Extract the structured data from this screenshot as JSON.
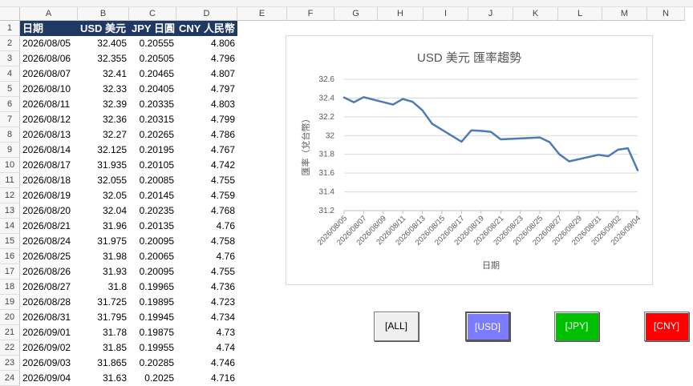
{
  "columns": [
    "A",
    "B",
    "C",
    "D",
    "E",
    "F",
    "G",
    "H",
    "I",
    "J",
    "K",
    "L",
    "M",
    "N"
  ],
  "headers": {
    "date": "日期",
    "usd": "USD 美元",
    "jpy": "JPY 日圓",
    "cny": "CNY 人民幣"
  },
  "rows": [
    [
      "2026/08/05",
      "32.405",
      "0.20555",
      "4.806"
    ],
    [
      "2026/08/06",
      "32.355",
      "0.20505",
      "4.796"
    ],
    [
      "2026/08/07",
      "32.41",
      "0.20465",
      "4.807"
    ],
    [
      "2026/08/10",
      "32.33",
      "0.20405",
      "4.797"
    ],
    [
      "2026/08/11",
      "32.39",
      "0.20335",
      "4.803"
    ],
    [
      "2026/08/12",
      "32.36",
      "0.20315",
      "4.799"
    ],
    [
      "2026/08/13",
      "32.27",
      "0.20265",
      "4.786"
    ],
    [
      "2026/08/14",
      "32.125",
      "0.20195",
      "4.767"
    ],
    [
      "2026/08/17",
      "31.935",
      "0.20105",
      "4.742"
    ],
    [
      "2026/08/18",
      "32.055",
      "0.20085",
      "4.755"
    ],
    [
      "2026/08/19",
      "32.05",
      "0.20145",
      "4.759"
    ],
    [
      "2026/08/20",
      "32.04",
      "0.20235",
      "4.768"
    ],
    [
      "2026/08/21",
      "31.96",
      "0.20135",
      "4.76"
    ],
    [
      "2026/08/24",
      "31.975",
      "0.20095",
      "4.758"
    ],
    [
      "2026/08/25",
      "31.98",
      "0.20065",
      "4.76"
    ],
    [
      "2026/08/26",
      "31.93",
      "0.20095",
      "4.755"
    ],
    [
      "2026/08/27",
      "31.8",
      "0.19965",
      "4.736"
    ],
    [
      "2026/08/28",
      "31.725",
      "0.19895",
      "4.723"
    ],
    [
      "2026/08/31",
      "31.795",
      "0.19945",
      "4.734"
    ],
    [
      "2026/09/01",
      "31.78",
      "0.19875",
      "4.73"
    ],
    [
      "2026/09/02",
      "31.85",
      "0.19955",
      "4.74"
    ],
    [
      "2026/09/03",
      "31.865",
      "0.20285",
      "4.746"
    ],
    [
      "2026/09/04",
      "31.63",
      "0.2025",
      "4.716"
    ]
  ],
  "buttons": {
    "all": "[ALL]",
    "usd": "[USD]",
    "jpy": "[JPY]",
    "cny": "[CNY]"
  },
  "chart_data": {
    "type": "line",
    "title": "USD 美元 匯率趨勢",
    "xlabel": "日期",
    "ylabel": "匯率（兌台幣）",
    "ylim": [
      31.2,
      32.6
    ],
    "yticks": [
      "31.2",
      "31.4",
      "31.6",
      "31.8",
      "32",
      "32.2",
      "32.4",
      "32.6"
    ],
    "grid": true,
    "x_axis_type": "date",
    "xticks": [
      "2026/08/05",
      "2026/08/07",
      "2026/08/09",
      "2026/08/11",
      "2026/08/13",
      "2026/08/15",
      "2026/08/17",
      "2026/08/19",
      "2026/08/21",
      "2026/08/23",
      "2026/08/25",
      "2026/08/27",
      "2026/08/29",
      "2026/08/31",
      "2026/09/02",
      "2026/09/04"
    ],
    "series_color": "#4e7ab5",
    "series": [
      {
        "x": [
          "2026/08/05",
          "2026/08/06",
          "2026/08/07",
          "2026/08/10",
          "2026/08/11",
          "2026/08/12",
          "2026/08/13",
          "2026/08/14",
          "2026/08/17",
          "2026/08/18",
          "2026/08/19",
          "2026/08/20",
          "2026/08/21",
          "2026/08/24",
          "2026/08/25",
          "2026/08/26",
          "2026/08/27",
          "2026/08/28",
          "2026/08/31",
          "2026/09/01",
          "2026/09/02",
          "2026/09/03",
          "2026/09/04"
        ],
        "values": [
          32.405,
          32.355,
          32.41,
          32.33,
          32.39,
          32.36,
          32.27,
          32.125,
          31.935,
          32.055,
          32.05,
          32.04,
          31.96,
          31.975,
          31.98,
          31.93,
          31.8,
          31.725,
          31.795,
          31.78,
          31.85,
          31.865,
          31.63
        ]
      }
    ]
  }
}
